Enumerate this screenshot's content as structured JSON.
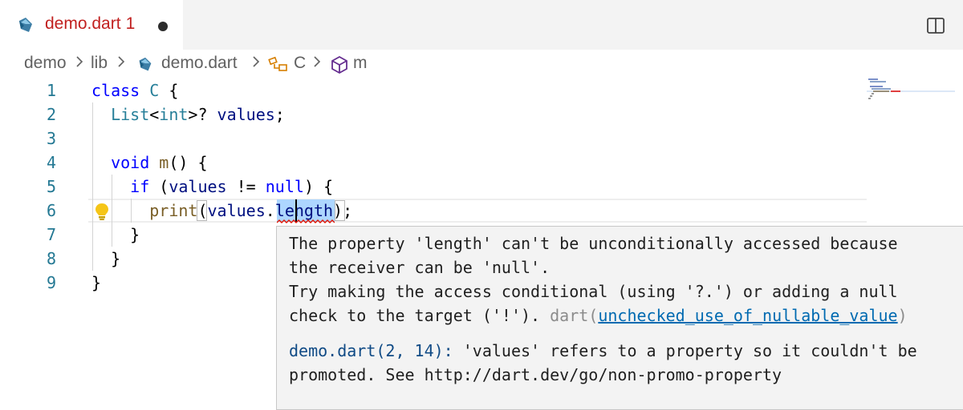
{
  "tab": {
    "title": "demo.dart",
    "problem_count": "1",
    "icon": "dart-file-icon",
    "dirty": true
  },
  "breadcrumb": {
    "items": [
      "demo",
      "lib",
      "demo.dart",
      "C",
      "m"
    ]
  },
  "editor": {
    "line_numbers": [
      "1",
      "2",
      "3",
      "4",
      "5",
      "6",
      "7",
      "8",
      "9"
    ],
    "lines": [
      [
        {
          "t": "class",
          "c": "kw"
        },
        {
          "t": " C",
          "c": "ty"
        },
        {
          "t": " {",
          "c": "pl"
        }
      ],
      [
        {
          "t": "  List",
          "c": "ty"
        },
        {
          "t": "<",
          "c": "pl"
        },
        {
          "t": "int",
          "c": "ty"
        },
        {
          "t": ">? ",
          "c": "pl"
        },
        {
          "t": "values",
          "c": "id"
        },
        {
          "t": ";",
          "c": "pl"
        }
      ],
      [],
      [
        {
          "t": "  void",
          "c": "kw"
        },
        {
          "t": " m",
          "c": "fn"
        },
        {
          "t": "() {",
          "c": "pl"
        }
      ],
      [
        {
          "t": "    if",
          "c": "kw"
        },
        {
          "t": " (",
          "c": "pl"
        },
        {
          "t": "values",
          "c": "id"
        },
        {
          "t": " != ",
          "c": "pl"
        },
        {
          "t": "null",
          "c": "kw"
        },
        {
          "t": ") {",
          "c": "pl"
        }
      ],
      [
        {
          "t": "      print",
          "c": "fn"
        },
        {
          "t": "(",
          "c": "pl"
        },
        {
          "t": "values",
          "c": "id"
        },
        {
          "t": ".",
          "c": "pl"
        },
        {
          "t": "length",
          "c": "id"
        },
        {
          "t": ");",
          "c": "pl"
        }
      ],
      [
        {
          "t": "    }",
          "c": "pl"
        }
      ],
      [
        {
          "t": "  }",
          "c": "pl"
        }
      ],
      [
        {
          "t": "}",
          "c": "pl"
        }
      ]
    ]
  },
  "hover": {
    "line1": "The property 'length' can't be unconditionally accessed because",
    "line2": "the receiver can be 'null'.",
    "line3": "Try making the access conditional (using '?.') or adding a null",
    "line4_text": "check to the target ('!'). ",
    "source": "dart",
    "paren_open": "(",
    "code": "unchecked_use_of_nullable_value",
    "paren_close": ")",
    "related_location": "demo.dart(2, 14):",
    "related_msg1": " 'values' refers to a property so it couldn't be",
    "related_msg2": "promoted. See http://dart.dev/go/non-promo-property"
  },
  "colors": {
    "error_tab": "#c1201f",
    "keyword": "#0000ff",
    "type": "#267f99",
    "function": "#795e26",
    "identifier": "#001080",
    "line_number": "#237893",
    "link": "#006ab1",
    "bulb": "#f5c517"
  }
}
